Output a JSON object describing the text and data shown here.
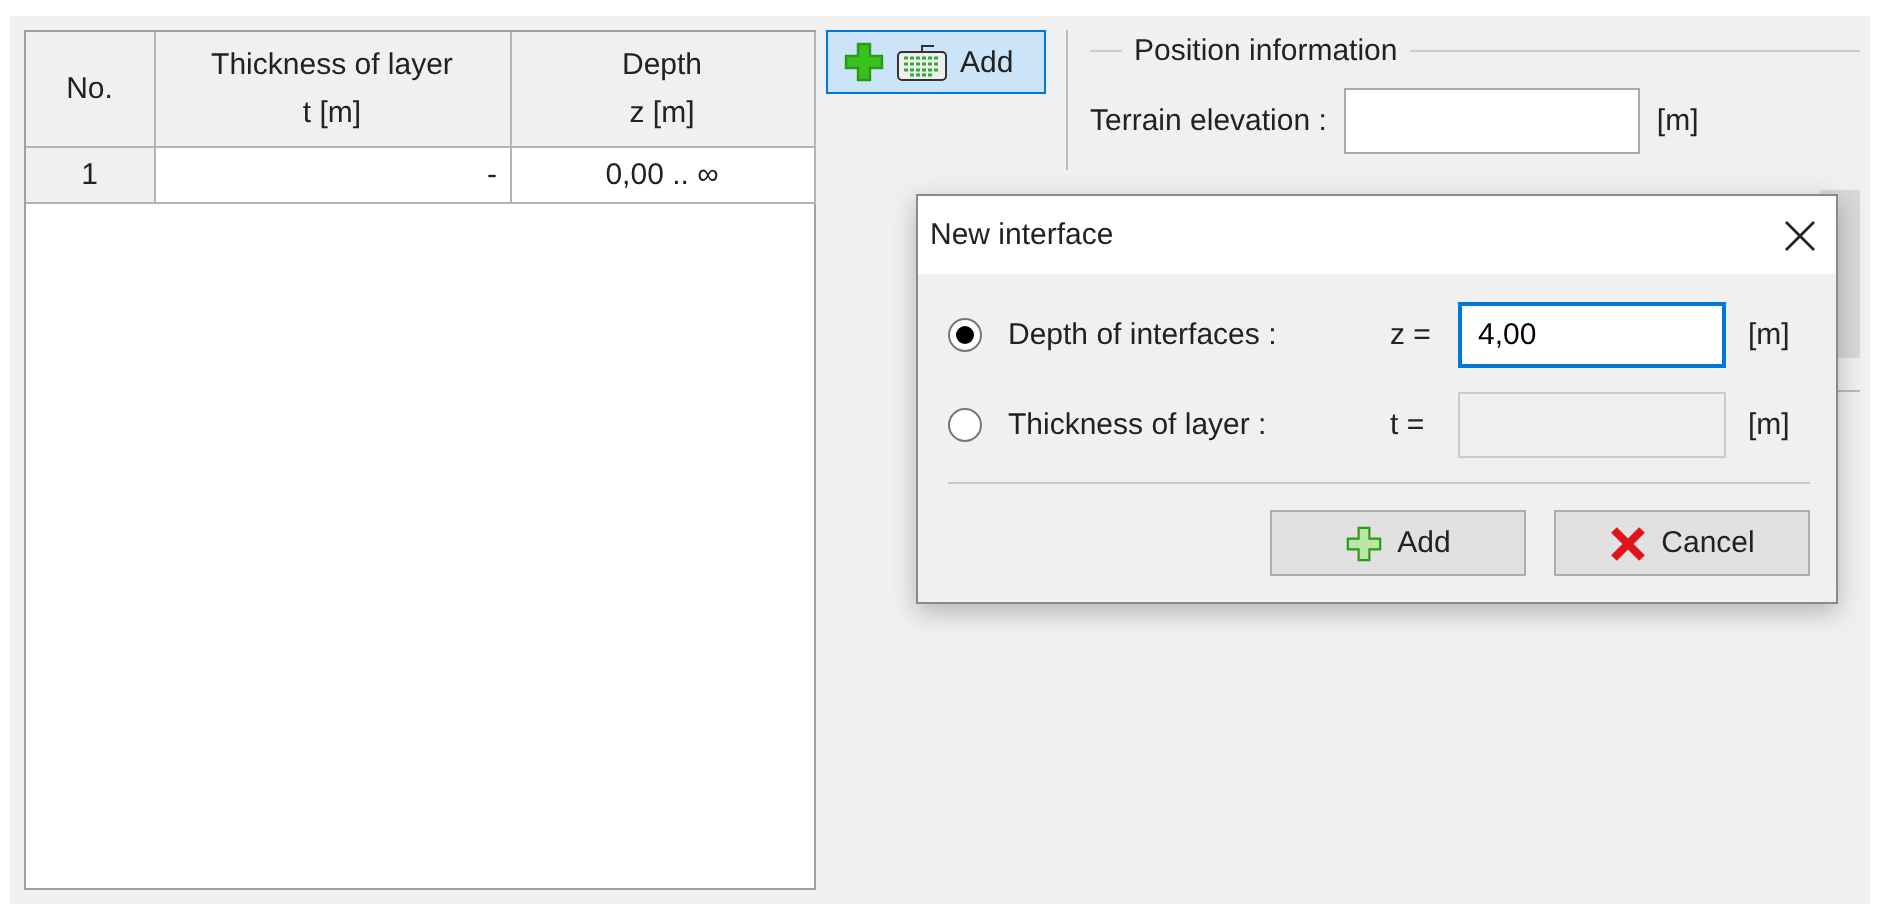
{
  "table": {
    "columns": [
      {
        "title": "No."
      },
      {
        "title": "Thickness of layer",
        "unit": "t [m]"
      },
      {
        "title": "Depth",
        "unit": "z [m]"
      }
    ],
    "rows": [
      [
        "1",
        "-",
        "0,00 .. ∞"
      ]
    ]
  },
  "toolbar": {
    "add_button": "Add"
  },
  "position_information": {
    "title": "Position information",
    "fields": [
      {
        "label": "Terrain elevation :",
        "unit": "[m]"
      }
    ]
  },
  "dialog": {
    "title": "New interface",
    "options": [
      {
        "label": "Depth of interfaces :",
        "symbol": "z =",
        "value": "4,00",
        "unit": "[m]",
        "selected": true
      },
      {
        "label": "Thickness of layer :",
        "symbol": "t =",
        "unit": "[m]",
        "selected": false
      }
    ],
    "buttons": [
      {
        "kind": "add",
        "label": "Add"
      },
      {
        "kind": "cancel",
        "label": "Cancel"
      }
    ]
  }
}
